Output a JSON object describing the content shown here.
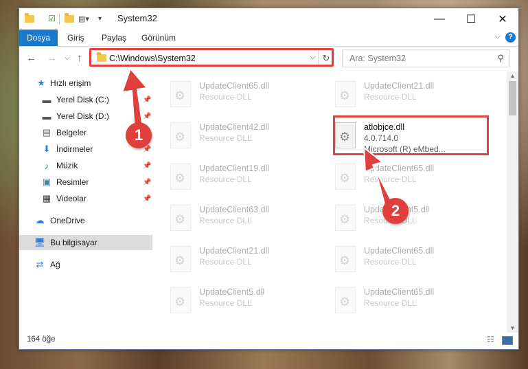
{
  "window": {
    "title": "System32",
    "controls": {
      "minimize": "—",
      "maximize": "☐",
      "close": "✕"
    }
  },
  "ribbon": {
    "tabs": [
      {
        "label": "Dosya"
      },
      {
        "label": "Giriş"
      },
      {
        "label": "Paylaş"
      },
      {
        "label": "Görünüm"
      }
    ],
    "help": "?"
  },
  "navbar": {
    "address": "C:\\Windows\\System32",
    "search_placeholder": "Ara: System32"
  },
  "sidebar": {
    "items": [
      {
        "label": "Hızlı erişim",
        "icon": "star-icon",
        "pinned": false
      },
      {
        "label": "Yerel Disk (C:)",
        "icon": "drive-icon",
        "pinned": true
      },
      {
        "label": "Yerel Disk (D:)",
        "icon": "drive-icon",
        "pinned": true
      },
      {
        "label": "Belgeler",
        "icon": "document-icon",
        "pinned": true
      },
      {
        "label": "İndirmeler",
        "icon": "download-icon",
        "pinned": true
      },
      {
        "label": "Müzik",
        "icon": "music-icon",
        "pinned": true
      },
      {
        "label": "Resimler",
        "icon": "picture-icon",
        "pinned": true
      },
      {
        "label": "Videolar",
        "icon": "video-icon",
        "pinned": true
      },
      {
        "label": "OneDrive",
        "icon": "cloud-icon",
        "pinned": false
      },
      {
        "label": "Bu bilgisayar",
        "icon": "computer-icon",
        "pinned": false,
        "selected": true
      },
      {
        "label": "Ağ",
        "icon": "network-icon",
        "pinned": false
      }
    ]
  },
  "files": [
    {
      "name": "UpdateClient65.dll",
      "type": "Resource DLL"
    },
    {
      "name": "UpdateClient21.dll",
      "type": "Resource DLL"
    },
    {
      "name": "UpdateClient42.dll",
      "type": "Resource DLL"
    },
    {
      "name": "atlobjce.dll",
      "version": "4.0.714.0",
      "company": "Microsoft (R) eMbed...",
      "active": true
    },
    {
      "name": "UpdateClient19.dll",
      "type": "Resource DLL"
    },
    {
      "name": "UpdateClient65.dll",
      "type": "Resource DLL"
    },
    {
      "name": "UpdateClient63.dll",
      "type": "Resource DLL"
    },
    {
      "name": "UpdateClient5.dll",
      "type": "Resource DLL"
    },
    {
      "name": "UpdateClient21.dll",
      "type": "Resource DLL"
    },
    {
      "name": "UpdateClient65.dll",
      "type": "Resource DLL"
    },
    {
      "name": "UpdateClient5.dll",
      "type": "Resource DLL"
    },
    {
      "name": "UpdateClient65.dll",
      "type": "Resource DLL"
    }
  ],
  "status": {
    "item_count": "164 öğe"
  },
  "annotations": [
    {
      "label": "1"
    },
    {
      "label": "2"
    }
  ],
  "colors": {
    "accent": "#1979ca",
    "highlight": "#e0403d"
  }
}
